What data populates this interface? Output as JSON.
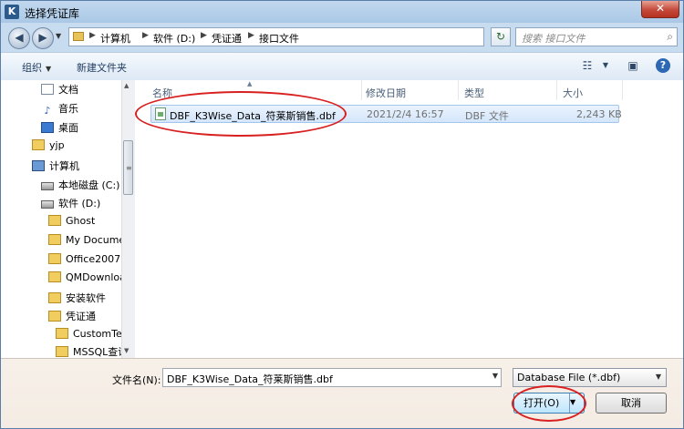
{
  "window": {
    "title": "选择凭证库",
    "close_label": "✕"
  },
  "address": {
    "crumbs": [
      "计算机",
      "软件 (D:)",
      "凭证通",
      "接口文件"
    ],
    "search_placeholder": "搜索 接口文件"
  },
  "toolbar": {
    "organize": "组织",
    "new_folder": "新建文件夹"
  },
  "nav": {
    "items": [
      "文档",
      "音乐",
      "桌面",
      "yjp",
      "计算机",
      "本地磁盘 (C:)",
      "软件 (D:)",
      "Ghost",
      "My Docume",
      "Office2007",
      "QMDownloa",
      "安装软件",
      "凭证通",
      "CustomTe",
      "MSSQL查询"
    ]
  },
  "columns": {
    "name": "名称",
    "modified": "修改日期",
    "type": "类型",
    "size": "大小"
  },
  "files": [
    {
      "name": "DBF_K3Wise_Data_符莱斯销售.dbf",
      "modified": "2021/2/4 16:57",
      "type": "DBF 文件",
      "size": "2,243 KB"
    }
  ],
  "footer": {
    "filename_label": "文件名(N):",
    "filename_value": "DBF_K3Wise_Data_符莱斯销售.dbf",
    "filetype_value": "Database File (*.dbf)",
    "open_label": "打开(O)",
    "cancel_label": "取消"
  },
  "colors": {
    "annotation": "#d82020",
    "selection": "#d4e6fb"
  }
}
